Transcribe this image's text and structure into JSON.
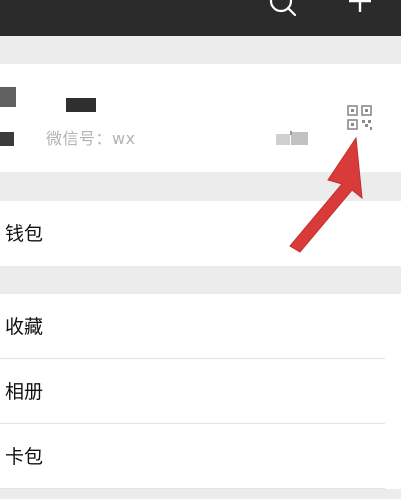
{
  "topbar": {
    "icons": [
      "search-icon",
      "plus-icon"
    ]
  },
  "profile": {
    "wechat_id_label": "微信号：wx",
    "icons": [
      "qr-code-icon"
    ]
  },
  "menu": {
    "wallet": "钱包",
    "favorites": "收藏",
    "album": "相册",
    "cards": "卡包"
  },
  "annotation": {
    "arrow_color": "#d93a3a"
  },
  "colors": {
    "topbar_bg": "#2b2b2b",
    "page_bg": "#ececec",
    "card_bg": "#ffffff"
  }
}
